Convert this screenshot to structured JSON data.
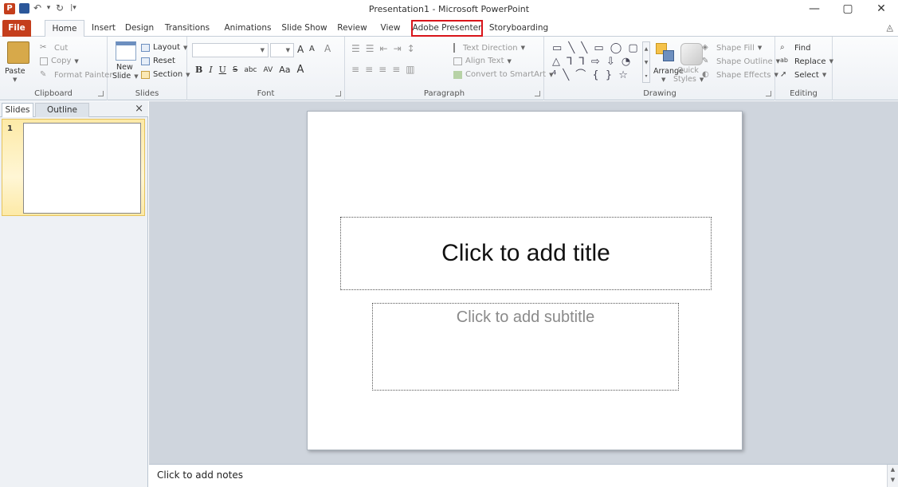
{
  "window": {
    "title": "Presentation1  -  Microsoft PowerPoint",
    "app_icon": "P",
    "controls": {
      "minimize": "—",
      "restore": "▢",
      "close": "✕"
    },
    "help": "◬"
  },
  "qat": {
    "undo": "↶",
    "dropdown": "▾",
    "redo": "↻",
    "customize": "|▾"
  },
  "tabs": [
    {
      "label": "File"
    },
    {
      "label": "Home"
    },
    {
      "label": "Insert"
    },
    {
      "label": "Design"
    },
    {
      "label": "Transitions"
    },
    {
      "label": "Animations"
    },
    {
      "label": "Slide Show"
    },
    {
      "label": "Review"
    },
    {
      "label": "View"
    },
    {
      "label": "Adobe Presenter"
    },
    {
      "label": "Storyboarding"
    }
  ],
  "ribbon": {
    "clipboard": {
      "label": "Clipboard",
      "paste": "Paste",
      "cut": "Cut",
      "copy": "Copy",
      "format_painter": "Format Painter"
    },
    "slides": {
      "label": "Slides",
      "new_slide": "New",
      "new_slide2": "Slide",
      "layout": "Layout",
      "reset": "Reset",
      "section": "Section"
    },
    "font": {
      "label": "Font",
      "grow": "A",
      "shrink": "A",
      "clear": "A",
      "bold": "B",
      "italic": "I",
      "underline": "U",
      "strike": "S",
      "shadow": "abc",
      "spacing": "AV",
      "case": "Aa"
    },
    "paragraph": {
      "label": "Paragraph",
      "text_direction": "Text Direction",
      "align_text": "Align Text",
      "convert_smartart": "Convert to SmartArt"
    },
    "drawing": {
      "label": "Drawing",
      "shapes_row1": "▭ ╲ ╲ ▭ ◯ ▢",
      "shapes_row2": "△ ⅂ ⅂ ⇨ ⇩ ◔",
      "shapes_row3": "⁴ ╲ ⌒ { } ☆",
      "arrange": "Arrange",
      "quick": "Quick",
      "styles": "Styles",
      "shape_fill": "Shape Fill",
      "shape_outline": "Shape Outline",
      "shape_effects": "Shape Effects"
    },
    "editing": {
      "label": "Editing",
      "find": "Find",
      "replace": "Replace",
      "select": "Select"
    }
  },
  "left_panel": {
    "tabs": [
      {
        "label": "Slides"
      },
      {
        "label": "Outline"
      }
    ],
    "close": "×",
    "thumb_number": "1"
  },
  "slide": {
    "title_placeholder": "Click to add title",
    "subtitle_placeholder": "Click to add subtitle"
  },
  "notes": {
    "placeholder": "Click to add notes"
  },
  "colors": {
    "file_tab": "#c43e1c",
    "highlight": "#d9141a",
    "accent": "#2b579a"
  }
}
